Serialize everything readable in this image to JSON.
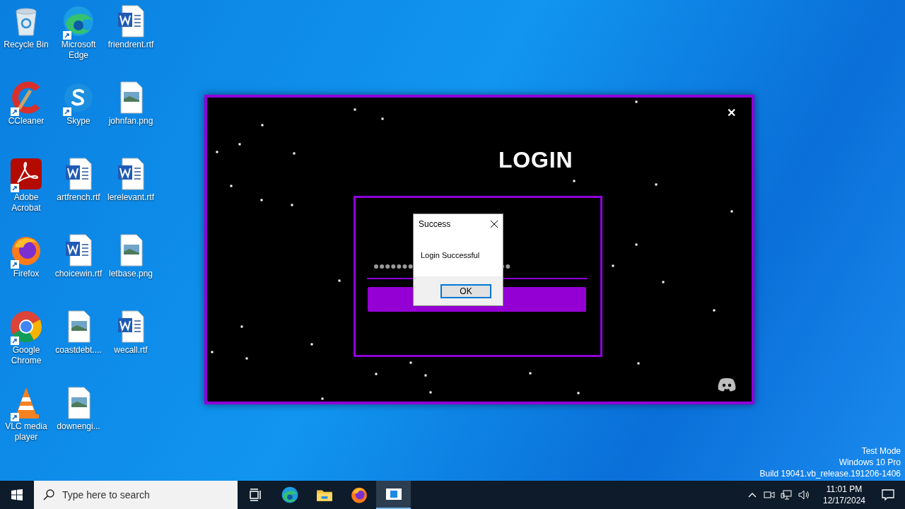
{
  "desktop_icons": [
    {
      "label": "Recycle Bin",
      "kind": "recycle",
      "shortcut": false
    },
    {
      "label": "CCleaner",
      "kind": "ccleaner",
      "shortcut": true
    },
    {
      "label": "Adobe Acrobat",
      "kind": "acrobat",
      "shortcut": true
    },
    {
      "label": "Firefox",
      "kind": "firefox",
      "shortcut": true
    },
    {
      "label": "Google Chrome",
      "kind": "chrome",
      "shortcut": true
    },
    {
      "label": "VLC media player",
      "kind": "vlc",
      "shortcut": true
    },
    {
      "label": "Microsoft Edge",
      "kind": "edge",
      "shortcut": true
    },
    {
      "label": "Skype",
      "kind": "skype",
      "shortcut": true
    },
    {
      "label": "artfrench.rtf",
      "kind": "word",
      "shortcut": false
    },
    {
      "label": "choicewin.rtf",
      "kind": "word",
      "shortcut": false
    },
    {
      "label": "coastdebt....",
      "kind": "image",
      "shortcut": false
    },
    {
      "label": "downengi...",
      "kind": "image",
      "shortcut": false
    },
    {
      "label": "friendrent.rtf",
      "kind": "word",
      "shortcut": false
    },
    {
      "label": "johnfan.png",
      "kind": "image",
      "shortcut": false
    },
    {
      "label": "lerelevant.rtf",
      "kind": "word",
      "shortcut": false
    },
    {
      "label": "letbase.png",
      "kind": "image",
      "shortcut": false
    },
    {
      "label": "wecall.rtf",
      "kind": "word",
      "shortcut": false
    }
  ],
  "login_window": {
    "title": "LOGIN",
    "close": "✕"
  },
  "dialog": {
    "title": "Success",
    "message": "Login Successful",
    "button": "OK"
  },
  "watermark": [
    "Test Mode",
    "Windows 10 Pro",
    "Build 19041.vb_release.191206-1406"
  ],
  "taskbar": {
    "search_placeholder": "Type here to search",
    "apps": [
      {
        "kind": "taskview",
        "active": false
      },
      {
        "kind": "edge",
        "active": false
      },
      {
        "kind": "explorer",
        "active": false
      },
      {
        "kind": "firefox",
        "active": false
      },
      {
        "kind": "window",
        "active": true
      }
    ],
    "time": "11:01 PM",
    "date": "12/17/2024"
  }
}
